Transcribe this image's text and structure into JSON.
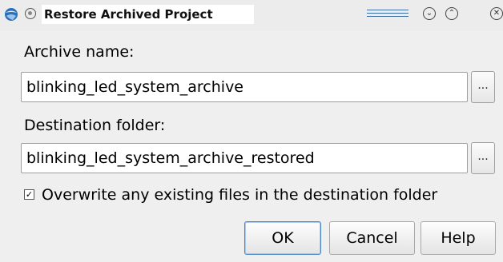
{
  "window": {
    "title": "Restore Archived Project",
    "icons": {
      "app": "app-logo-icon",
      "menu": "window-menu-icon",
      "minimize": "chevron-down-icon",
      "maximize": "chevron-up-icon",
      "close": "close-icon"
    },
    "minimize_glyph": "⌄",
    "maximize_glyph": "⌃",
    "close_glyph": "✕"
  },
  "archive": {
    "label": "Archive name:",
    "value": "blinking_led_system_archive",
    "browse_label": "..."
  },
  "destination": {
    "label": "Destination folder:",
    "value": "blinking_led_system_archive_restored",
    "browse_label": "..."
  },
  "overwrite": {
    "checked": true,
    "check_glyph": "✓",
    "label": "Overwrite any existing files in the destination folder"
  },
  "buttons": {
    "ok": "OK",
    "cancel": "Cancel",
    "help": "Help"
  },
  "colors": {
    "accent": "#4a86c8",
    "background": "#efefef"
  }
}
